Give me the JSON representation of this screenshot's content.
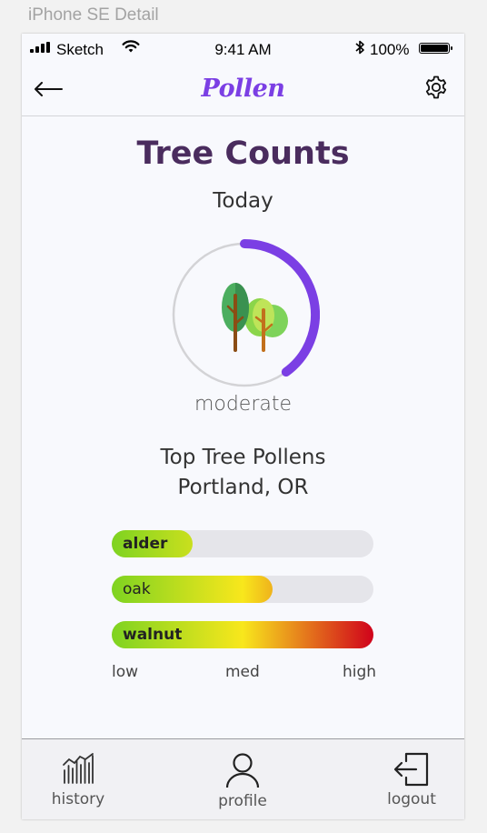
{
  "artboard": {
    "title": "iPhone SE Detail"
  },
  "status_bar": {
    "carrier": "Sketch",
    "time": "9:41 AM",
    "battery": "100%"
  },
  "nav": {
    "brand": "Pollen"
  },
  "main": {
    "title": "Tree Counts",
    "subtitle": "Today",
    "level_label": "moderate",
    "level_fraction": 0.4,
    "section_title_line1": "Top Tree Pollens",
    "section_title_line2": "Portland, OR"
  },
  "pollens": [
    {
      "name": "alder",
      "level": 0.31,
      "bold": true
    },
    {
      "name": "oak",
      "level": 0.615,
      "bold": false
    },
    {
      "name": "walnut",
      "level": 1.0,
      "bold": true
    }
  ],
  "scale": {
    "low": "low",
    "med": "med",
    "high": "high"
  },
  "tabs": [
    {
      "label": "history",
      "icon": "history-icon"
    },
    {
      "label": "profile",
      "icon": "profile-icon"
    },
    {
      "label": "logout",
      "icon": "logout-icon"
    }
  ],
  "colors": {
    "accent": "#7b3fe4",
    "title": "#4a2c5e",
    "bar_low": "#7ed321",
    "bar_med": "#f8e71c",
    "bar_high": "#d0021b"
  }
}
